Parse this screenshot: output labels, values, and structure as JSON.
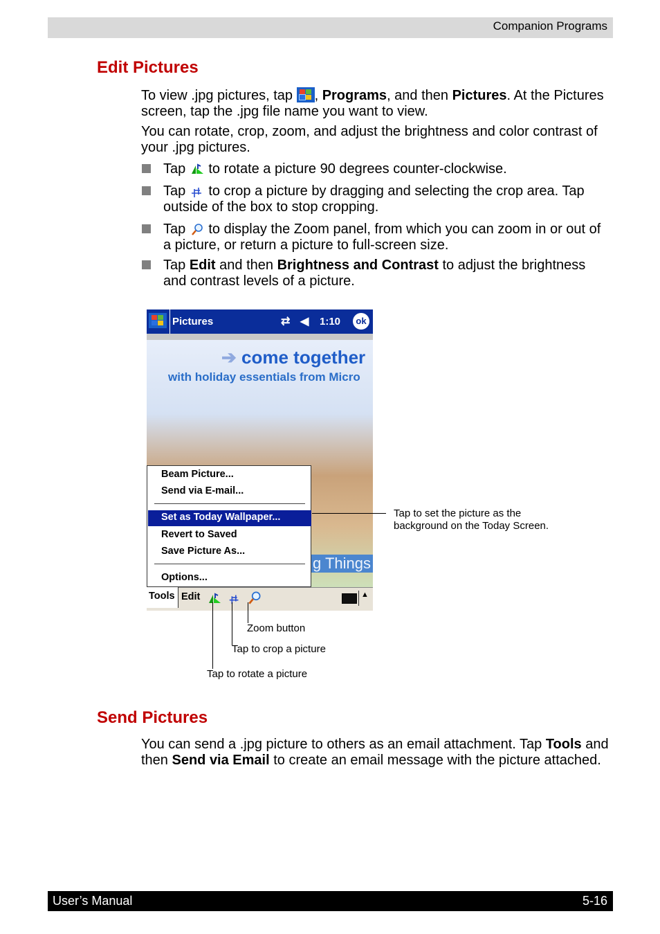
{
  "header": {
    "section": "Companion Programs"
  },
  "edit": {
    "heading": "Edit Pictures",
    "p1": {
      "a": "To view .jpg pictures, tap ",
      "b": ", ",
      "c": "Programs",
      "d": ", and then ",
      "e": "Pictures",
      "f": ". At the Pictures screen, tap the .jpg file name you want to view."
    },
    "p2": "You can rotate, crop, zoom, and adjust the brightness and color contrast of your .jpg pictures.",
    "bullets": [
      {
        "a": "Tap ",
        "b": " to rotate a picture 90 degrees counter-clockwise.",
        "icon": "rotate-icon"
      },
      {
        "a": "Tap ",
        "b": " to crop a picture by dragging and selecting the crop area. Tap outside of the box to stop cropping.",
        "icon": "crop-icon"
      },
      {
        "a": "Tap ",
        "b": " to display the Zoom panel, from which you can zoom in or out of a picture, or return a picture to full-screen size.",
        "icon": "zoom-icon"
      },
      {
        "a": "Tap ",
        "b": "Edit",
        "c": " and then ",
        "d": "Brightness and Contrast",
        "e": " to adjust the brightness and contrast levels of a picture."
      }
    ]
  },
  "screenshot": {
    "title": "Pictures",
    "time": "1:10",
    "ok": "ok",
    "banner1": "come together",
    "banner2": "with holiday essentials from Micro",
    "banner3": "g Things",
    "menu": [
      "Beam Picture...",
      "Send via E-mail...",
      "Set as Today Wallpaper...",
      "Revert to Saved",
      "Save Picture As...",
      "Options..."
    ],
    "toolbar": {
      "tools": "Tools",
      "edit": "Edit"
    },
    "accent": "#0a2d9a"
  },
  "callouts": {
    "wallpaper": "Tap to set the picture as the background on the Today Screen.",
    "zoom": "Zoom button",
    "crop": "Tap to crop a picture",
    "rotate": "Tap to rotate a picture"
  },
  "send": {
    "heading": "Send Pictures",
    "p": {
      "a": "You can send a .jpg picture to others as an email attachment. Tap ",
      "b": "Tools",
      "c": " and then ",
      "d": "Send via Email",
      "e": " to create an email message with the picture attached."
    }
  },
  "footer": {
    "left": "User’s Manual",
    "right": "5-16"
  }
}
